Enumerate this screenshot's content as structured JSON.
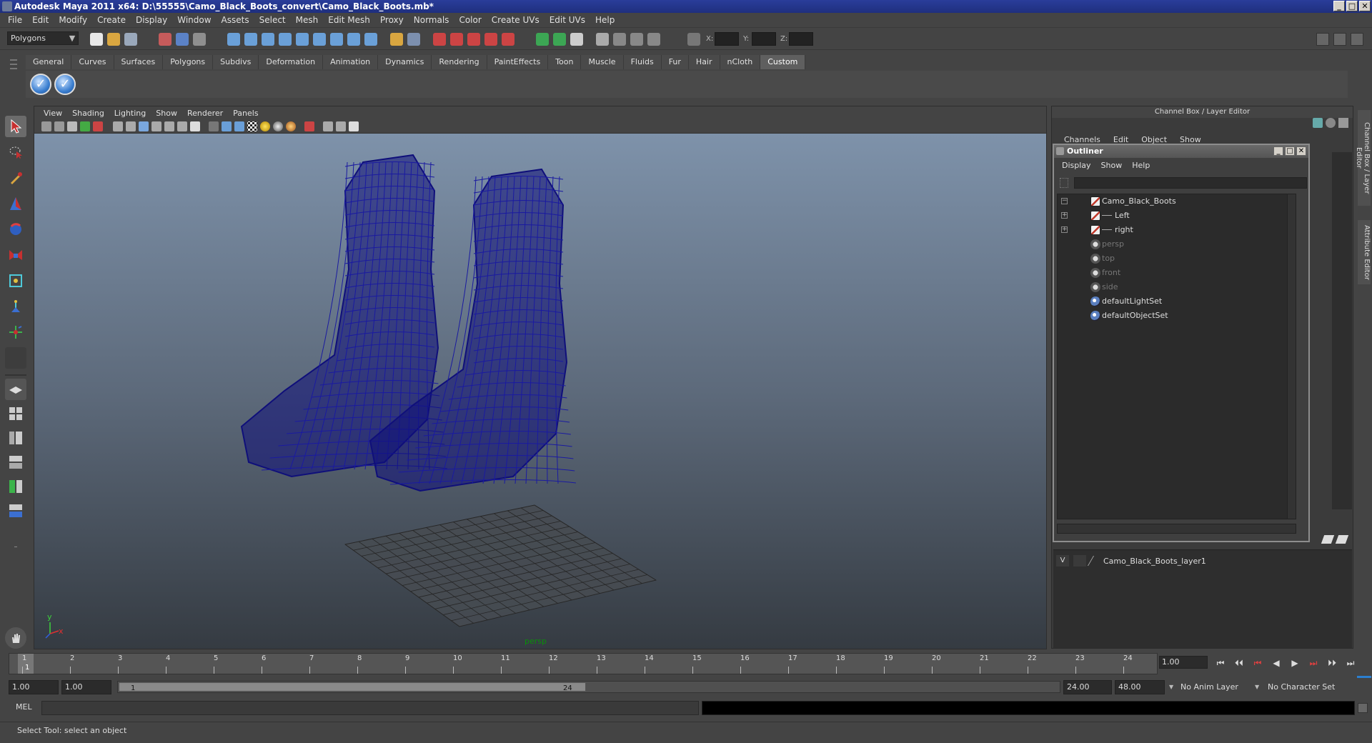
{
  "window": {
    "title": "Autodesk Maya 2011 x64: D:\\55555\\Camo_Black_Boots_convert\\Camo_Black_Boots.mb*",
    "min": "_",
    "max": "□",
    "close": "✕"
  },
  "menubar": [
    "File",
    "Edit",
    "Modify",
    "Create",
    "Display",
    "Window",
    "Assets",
    "Select",
    "Mesh",
    "Edit Mesh",
    "Proxy",
    "Normals",
    "Color",
    "Create UVs",
    "Edit UVs",
    "Help"
  ],
  "statusline": {
    "mode": "Polygons",
    "coord_x": "X:",
    "coord_y": "Y:",
    "coord_z": "Z:"
  },
  "shelf": {
    "tabs": [
      "General",
      "Curves",
      "Surfaces",
      "Polygons",
      "Subdivs",
      "Deformation",
      "Animation",
      "Dynamics",
      "Rendering",
      "PaintEffects",
      "Toon",
      "Muscle",
      "Fluids",
      "Fur",
      "Hair",
      "nCloth",
      "Custom"
    ],
    "active_tab": "Custom"
  },
  "viewport": {
    "menu": [
      "View",
      "Shading",
      "Lighting",
      "Show",
      "Renderer",
      "Panels"
    ],
    "camera_label": "persp",
    "axis_y": "y",
    "axis_x": "x",
    "wire_color": "#0f0f7a"
  },
  "channel_box": {
    "title": "Channel Box / Layer Editor",
    "menu": [
      "Channels",
      "Edit",
      "Object",
      "Show"
    ],
    "layer": {
      "visible": "V",
      "name": "Camo_Black_Boots_layer1"
    }
  },
  "side_tabs": {
    "channel": "Channel Box / Layer Editor",
    "attribute": "Attribute Editor"
  },
  "outliner": {
    "title": "Outliner",
    "menu": [
      "Display",
      "Show",
      "Help"
    ],
    "items": [
      {
        "label": "Camo_Black_Boots",
        "expander": "−",
        "icon": "transform-icon",
        "dim": false
      },
      {
        "label": "Left",
        "expander": "+",
        "icon": "transform-icon",
        "dim": false
      },
      {
        "label": "right",
        "expander": "+",
        "icon": "transform-icon",
        "dim": false
      },
      {
        "label": "persp",
        "expander": "",
        "icon": "camera-icon",
        "dim": true
      },
      {
        "label": "top",
        "expander": "",
        "icon": "camera-icon",
        "dim": true
      },
      {
        "label": "front",
        "expander": "",
        "icon": "camera-icon",
        "dim": true
      },
      {
        "label": "side",
        "expander": "",
        "icon": "camera-icon",
        "dim": true
      },
      {
        "label": "defaultLightSet",
        "expander": "",
        "icon": "set-icon",
        "dim": false
      },
      {
        "label": "defaultObjectSet",
        "expander": "",
        "icon": "set-icon",
        "dim": false
      }
    ]
  },
  "timeslider": {
    "ticks": [
      "1",
      "2",
      "3",
      "4",
      "5",
      "6",
      "7",
      "8",
      "9",
      "10",
      "11",
      "12",
      "13",
      "14",
      "15",
      "16",
      "17",
      "18",
      "19",
      "20",
      "21",
      "22",
      "23",
      "24"
    ],
    "current_frame": "1",
    "frame_field": "1.00"
  },
  "playback": [
    "⏮",
    "⏴⏴",
    "⏮",
    "◀",
    "▶",
    "⏭",
    "⏵⏵",
    "⏭"
  ],
  "rangeslider": {
    "start_time": "1.00",
    "playback_start": "1.00",
    "range_start_label": "1",
    "range_end_label": "24",
    "playback_end": "24.00",
    "end_time": "48.00",
    "anim_layer": "No Anim Layer",
    "character_set": "No Character Set"
  },
  "cmdline": {
    "label": "MEL"
  },
  "helpline": {
    "text": "Select Tool: select an object"
  }
}
